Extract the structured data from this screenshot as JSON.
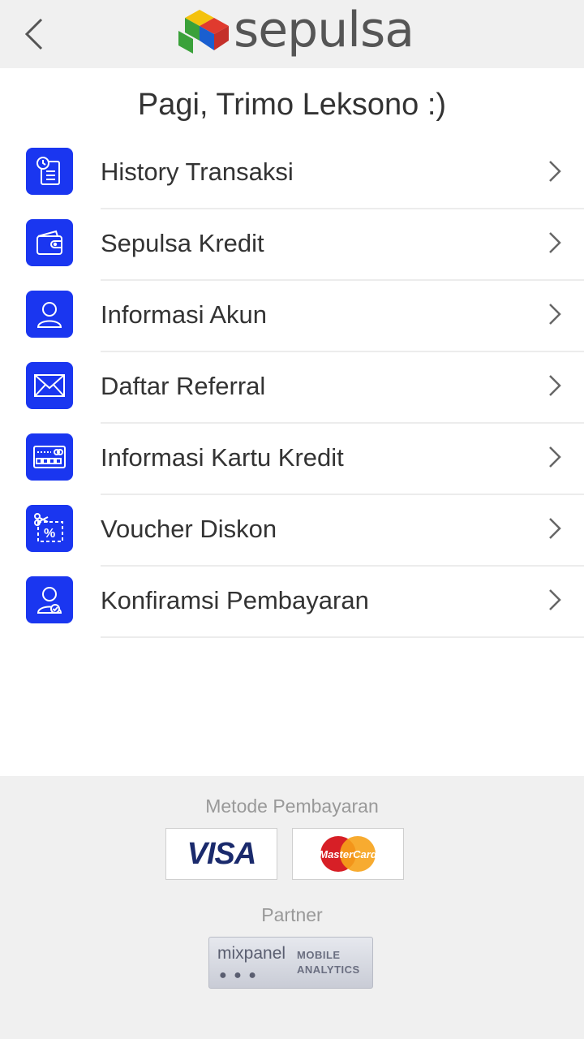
{
  "header": {
    "brand": "sepulsa",
    "back_icon": "chevron-left-icon"
  },
  "greeting": "Pagi, Trimo Leksono :)",
  "menu": [
    {
      "label": "History Transaksi",
      "icon": "history-document-icon"
    },
    {
      "label": "Sepulsa Kredit",
      "icon": "wallet-icon"
    },
    {
      "label": "Informasi Akun",
      "icon": "user-icon"
    },
    {
      "label": "Daftar Referral",
      "icon": "envelope-icon"
    },
    {
      "label": "Informasi Kartu Kredit",
      "icon": "credit-card-icon"
    },
    {
      "label": "Voucher Diskon",
      "icon": "voucher-percent-icon"
    },
    {
      "label": "Konfiramsi Pembayaran",
      "icon": "user-check-icon"
    }
  ],
  "footer": {
    "payment_label": "Metode Pembayaran",
    "visa": "VISA",
    "mastercard": "MasterCard",
    "partner_label": "Partner",
    "mixpanel": {
      "word": "mixpanel",
      "line1": "MOBILE",
      "line2": "ANALYTICS",
      "dots": "● ● ●"
    }
  },
  "colors": {
    "accent_blue": "#1a36f0",
    "header_bg": "#f0f0f0",
    "footer_bg": "#f0f0f0"
  }
}
